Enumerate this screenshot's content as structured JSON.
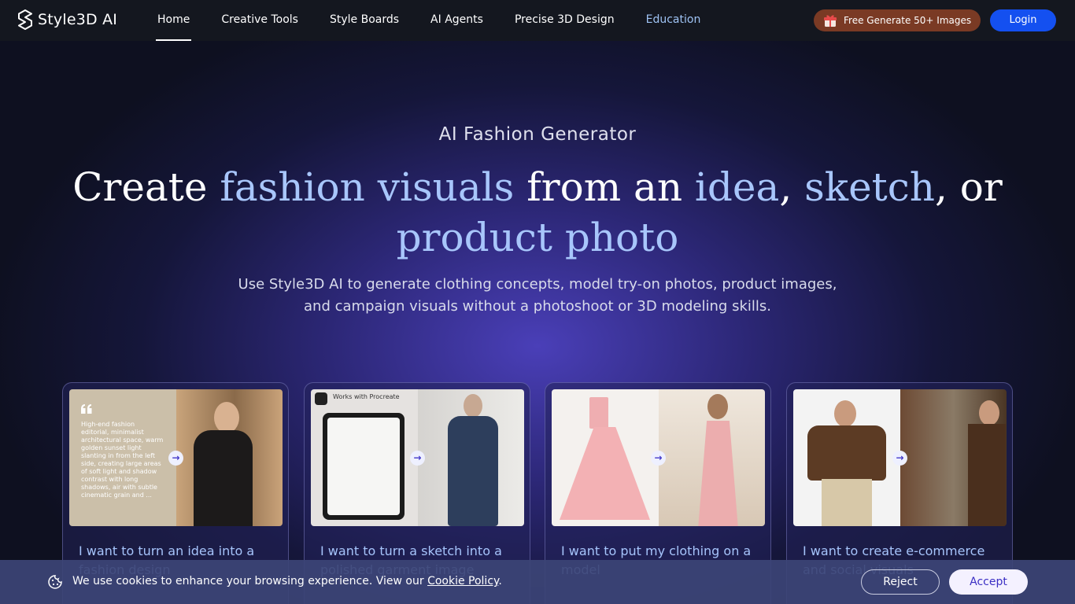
{
  "nav": {
    "logo_text": "Style3D AI",
    "links": [
      "Home",
      "Creative Tools",
      "Style Boards",
      "AI Agents",
      "Precise 3D Design",
      "Education"
    ],
    "free_label": "Free Generate 50+ Images",
    "login_label": "Login"
  },
  "hero": {
    "subtitle": "AI Fashion Generator",
    "title_part1": "Create ",
    "title_highlight1": "fashion visuals",
    "title_part2": " from an ",
    "title_highlight2": "idea",
    "title_part3": ", ",
    "title_highlight3": "sketch",
    "title_part4": ", or ",
    "title_highlight4": "product photo",
    "description": "Use Style3D AI to generate clothing concepts, model try-on photos, product images, and campaign visuals without a photoshoot or 3D modeling skills."
  },
  "cards": [
    {
      "title": "I want to turn an idea into a fashion design",
      "prompt_text": "High-end fashion editorial, minimalist architectural space, warm golden sunset light slanting in from the left side, creating large areas of soft light and shadow contrast with long shadows, air with subtle cinematic grain and ..."
    },
    {
      "title": "I want to turn a sketch into a polished garment image",
      "badge": "Works with Procreate"
    },
    {
      "title": "I want to put my clothing on a model"
    },
    {
      "title": "I want to create e-commerce and social visuals"
    }
  ],
  "cookie": {
    "text": "We use cookies to enhance your browsing experience. View our ",
    "link": "Cookie Policy",
    "period": ".",
    "reject": "Reject",
    "accept": "Accept"
  },
  "colors": {
    "accent": "#a8c6fb",
    "login": "#1450f0",
    "free_btn": "#7a3a24"
  },
  "icons": [
    "style3d-logo-icon",
    "gift-icon",
    "arrow-right-icon",
    "cookie-icon",
    "quote-icon",
    "procreate-icon"
  ]
}
